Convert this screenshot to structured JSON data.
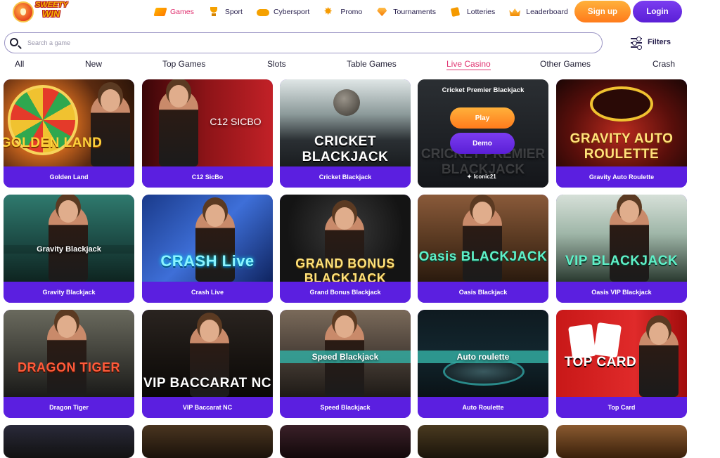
{
  "brand": {
    "line1": "SWEETY",
    "line2": "WIN"
  },
  "nav": [
    {
      "label": "Games",
      "icon": "games-icon",
      "active": true
    },
    {
      "label": "Sport",
      "icon": "trophy-icon",
      "active": false
    },
    {
      "label": "Cybersport",
      "icon": "gamepad-icon",
      "active": false
    },
    {
      "label": "Promo",
      "icon": "promo-icon",
      "active": false
    },
    {
      "label": "Tournaments",
      "icon": "diamond-icon",
      "active": false
    },
    {
      "label": "Lotteries",
      "icon": "ticket-icon",
      "active": false
    },
    {
      "label": "Leaderboard",
      "icon": "crown-icon",
      "active": false
    }
  ],
  "auth": {
    "signup": "Sign up",
    "login": "Login"
  },
  "search": {
    "placeholder": "Search a game",
    "value": ""
  },
  "filters": {
    "label": "Filters"
  },
  "tabs": [
    {
      "label": "All",
      "active": false
    },
    {
      "label": "New",
      "active": false
    },
    {
      "label": "Top Games",
      "active": false
    },
    {
      "label": "Slots",
      "active": false
    },
    {
      "label": "Table Games",
      "active": false
    },
    {
      "label": "Live Casino",
      "active": true
    },
    {
      "label": "Other Games",
      "active": false
    },
    {
      "label": "Crash",
      "active": false
    }
  ],
  "games": [
    {
      "title": "Golden Land",
      "art_text": "GOLDEN LAND"
    },
    {
      "title": "C12 SicBo",
      "art_text": "C12 SICBO"
    },
    {
      "title": "Cricket Blackjack",
      "art_text": "CRICKET BLACKJACK"
    },
    {
      "title": "Cricket Premier Blackjack",
      "art_text": "CRICKET PREMIER BLACKJACK",
      "hover": {
        "play": "Play",
        "demo": "Demo",
        "provider": "Iconic21"
      }
    },
    {
      "title": "Gravity Auto Roulette",
      "art_text": "GRAVITY AUTO ROULETTE"
    },
    {
      "title": "Gravity Blackjack",
      "art_text": "Gravity Blackjack"
    },
    {
      "title": "Crash Live",
      "art_text": "CRASH Live"
    },
    {
      "title": "Grand Bonus Blackjack",
      "art_text": "GRAND BONUS BLACKJACK"
    },
    {
      "title": "Oasis Blackjack",
      "art_text": "Oasis BLACKJACK"
    },
    {
      "title": "Oasis VIP Blackjack",
      "art_text": "VIP BLACKJACK"
    },
    {
      "title": "Dragon Tiger",
      "art_text": "DRAGON TIGER"
    },
    {
      "title": "VIP Baccarat NC",
      "art_text": "VIP BACCARAT NC"
    },
    {
      "title": "Speed Blackjack",
      "art_text": "Speed Blackjack"
    },
    {
      "title": "Auto Roulette",
      "art_text": "Auto roulette"
    },
    {
      "title": "Top Card",
      "art_text": "TOP CARD"
    }
  ],
  "colors": {
    "accent": "#e0306f",
    "primary": "#5b1fe0",
    "orange": "#ff8a1f"
  }
}
